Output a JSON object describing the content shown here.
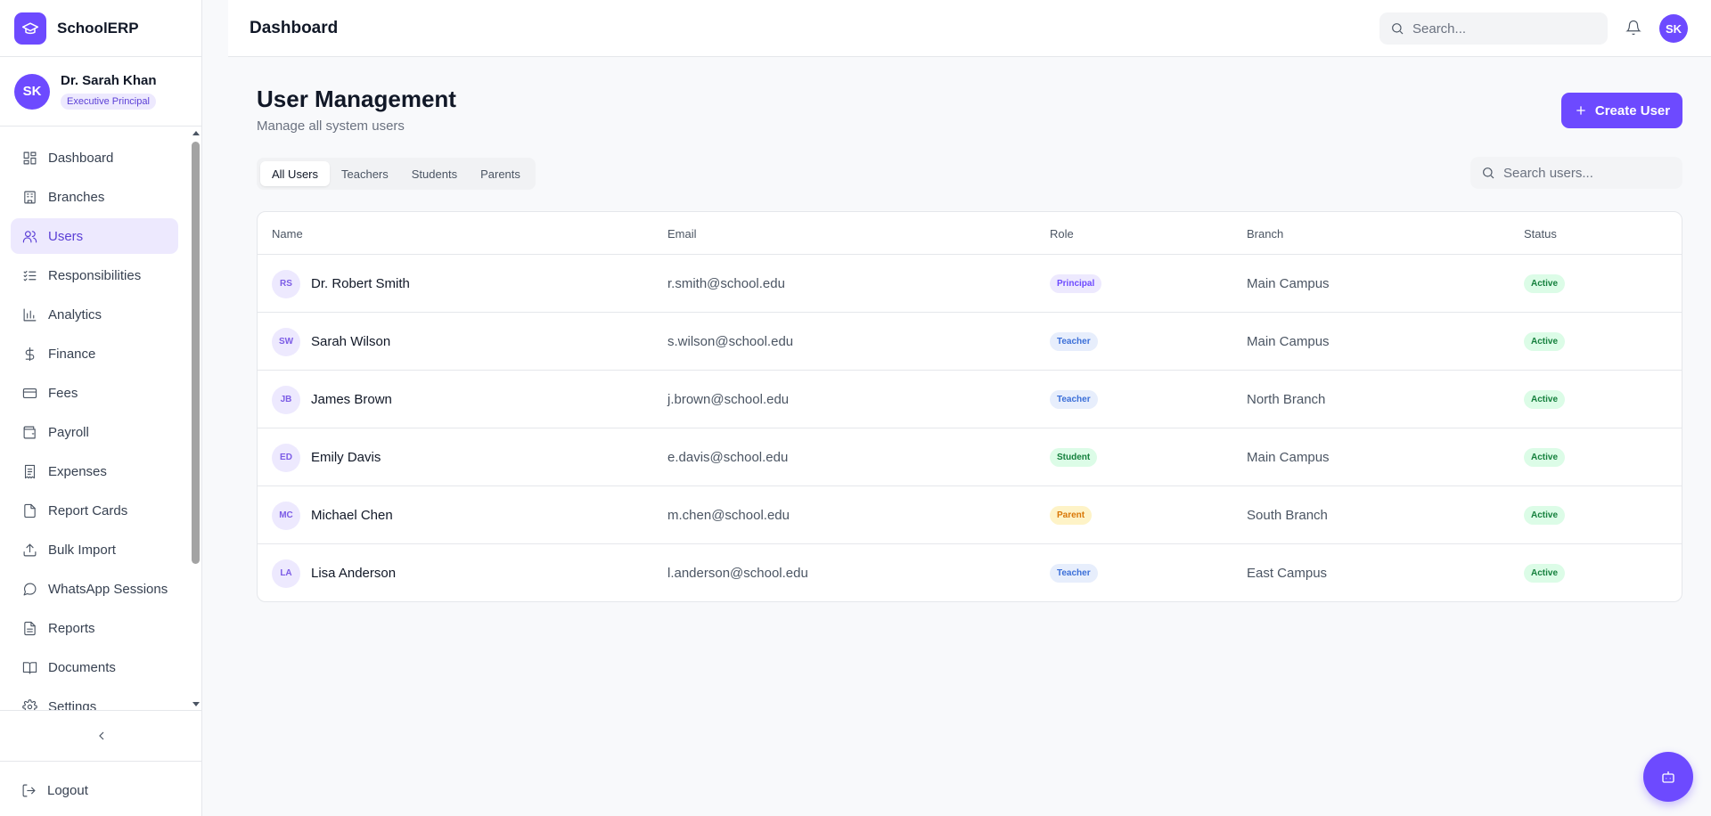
{
  "brand": {
    "name": "SchoolERP"
  },
  "profile": {
    "name": "Dr. Sarah Khan",
    "role": "Executive Principal",
    "initials": "SK"
  },
  "sidebar": {
    "items": [
      {
        "label": "Dashboard",
        "icon": "dashboard-icon",
        "active": false
      },
      {
        "label": "Branches",
        "icon": "building-icon",
        "active": false
      },
      {
        "label": "Users",
        "icon": "users-icon",
        "active": true
      },
      {
        "label": "Responsibilities",
        "icon": "list-check-icon",
        "active": false
      },
      {
        "label": "Analytics",
        "icon": "bar-chart-icon",
        "active": false
      },
      {
        "label": "Finance",
        "icon": "dollar-icon",
        "active": false
      },
      {
        "label": "Fees",
        "icon": "credit-card-icon",
        "active": false
      },
      {
        "label": "Payroll",
        "icon": "wallet-icon",
        "active": false
      },
      {
        "label": "Expenses",
        "icon": "receipt-icon",
        "active": false
      },
      {
        "label": "Report Cards",
        "icon": "document-icon",
        "active": false
      },
      {
        "label": "Bulk Import",
        "icon": "upload-icon",
        "active": false
      },
      {
        "label": "WhatsApp Sessions",
        "icon": "chat-icon",
        "active": false
      },
      {
        "label": "Reports",
        "icon": "file-text-icon",
        "active": false
      },
      {
        "label": "Documents",
        "icon": "book-icon",
        "active": false
      },
      {
        "label": "Settings",
        "icon": "gear-icon",
        "active": false
      }
    ],
    "logout_label": "Logout"
  },
  "header": {
    "title": "Dashboard",
    "search_placeholder": "Search...",
    "avatar_initials": "SK"
  },
  "main": {
    "title": "User Management",
    "subtitle": "Manage all system users",
    "create_label": "Create User",
    "tabs": [
      {
        "label": "All Users",
        "active": true
      },
      {
        "label": "Teachers",
        "active": false
      },
      {
        "label": "Students",
        "active": false
      },
      {
        "label": "Parents",
        "active": false
      }
    ],
    "search_placeholder": "Search users..."
  },
  "table": {
    "columns": [
      "Name",
      "Email",
      "Role",
      "Branch",
      "Status"
    ],
    "rows": [
      {
        "initials": "RS",
        "name": "Dr. Robert Smith",
        "email": "r.smith@school.edu",
        "role": "Principal",
        "role_type": "principal",
        "branch": "Main Campus",
        "status": "Active"
      },
      {
        "initials": "SW",
        "name": "Sarah Wilson",
        "email": "s.wilson@school.edu",
        "role": "Teacher",
        "role_type": "teacher",
        "branch": "Main Campus",
        "status": "Active"
      },
      {
        "initials": "JB",
        "name": "James Brown",
        "email": "j.brown@school.edu",
        "role": "Teacher",
        "role_type": "teacher",
        "branch": "North Branch",
        "status": "Active"
      },
      {
        "initials": "ED",
        "name": "Emily Davis",
        "email": "e.davis@school.edu",
        "role": "Student",
        "role_type": "student",
        "branch": "Main Campus",
        "status": "Active"
      },
      {
        "initials": "MC",
        "name": "Michael Chen",
        "email": "m.chen@school.edu",
        "role": "Parent",
        "role_type": "parent",
        "branch": "South Branch",
        "status": "Active"
      },
      {
        "initials": "LA",
        "name": "Lisa Anderson",
        "email": "l.anderson@school.edu",
        "role": "Teacher",
        "role_type": "teacher",
        "branch": "East Campus",
        "status": "Active"
      }
    ]
  },
  "colors": {
    "accent": "#6d4aff",
    "accent_light": "#ede9fe",
    "active_green": "#15803d"
  }
}
